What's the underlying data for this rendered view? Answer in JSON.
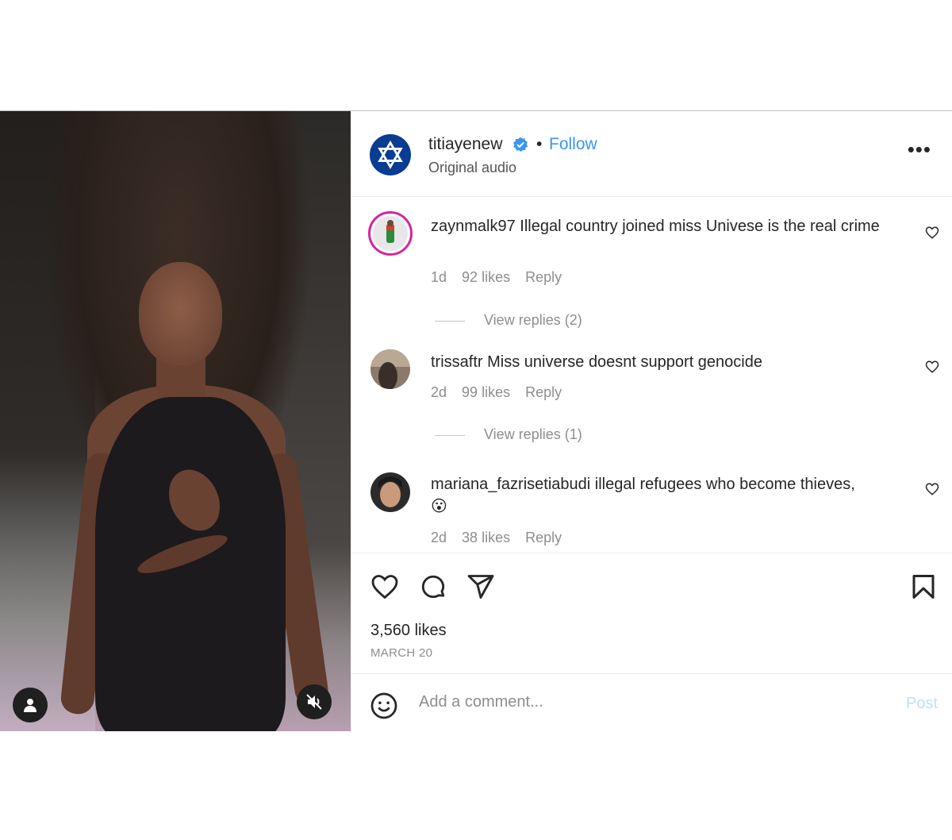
{
  "post": {
    "username": "titiayenew",
    "separator": "•",
    "follow_label": "Follow",
    "subtitle": "Original audio",
    "more_label": "•••"
  },
  "comments": [
    {
      "username": "zaynmalk97",
      "text": "Illegal country joined miss Univese is the real crime",
      "age": "1d",
      "likes": "92 likes",
      "reply_label": "Reply",
      "view_replies": "View replies (2)"
    },
    {
      "username": "trissaftr",
      "text": "Miss universe doesnt support genocide",
      "age": "2d",
      "likes": "99 likes",
      "reply_label": "Reply",
      "view_replies": "View replies (1)"
    },
    {
      "username": "mariana_fazrisetiabudi",
      "text": "illegal refugees who become thieves,",
      "emoji": "😮",
      "age": "2d",
      "likes": "38 likes",
      "reply_label": "Reply"
    }
  ],
  "stats": {
    "likes": "3,560 likes",
    "date": "MARCH 20"
  },
  "composer": {
    "placeholder": "Add a comment...",
    "post_label": "Post"
  },
  "icons": {
    "verified": "verified-badge-icon",
    "like": "heart-icon",
    "comment": "comment-bubble-icon",
    "share": "paper-plane-icon",
    "save": "bookmark-icon",
    "emoji": "smiley-icon",
    "user": "person-icon",
    "mute": "speaker-muted-icon"
  },
  "colors": {
    "accent": "#3897f0",
    "verified": "#3897f0",
    "post_disabled": "#c0dffd",
    "story_ring": "#d6249f"
  }
}
